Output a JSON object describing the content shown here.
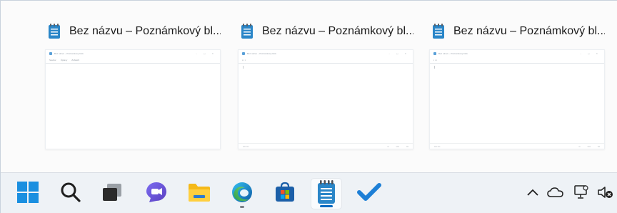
{
  "thumbnails": [
    {
      "title": "Bez názvu – Poznámkový bl...",
      "preview": {
        "app_title": "Bez názvu – Poznámkový blok",
        "menu": [
          "Soubor",
          "Úpravy",
          "Zobrazit"
        ],
        "status_left": "",
        "status_right": []
      }
    },
    {
      "title": "Bez názvu – Poznámkový bl...",
      "preview": {
        "app_title": "Bez názvu – Poznámkový blok",
        "menu": [],
        "status_left": "",
        "status_right": []
      }
    },
    {
      "title": "Bez názvu – Poznámkový bl...",
      "preview": {
        "app_title": "Bez názvu – Poznámkový blok",
        "menu": [],
        "status_left": "",
        "status_right": []
      }
    }
  ],
  "taskbar": {
    "apps": [
      {
        "name": "start",
        "icon": "windows-logo-icon"
      },
      {
        "name": "search",
        "icon": "search-icon"
      },
      {
        "name": "task-view",
        "icon": "task-view-icon"
      },
      {
        "name": "meet",
        "icon": "video-chat-icon"
      },
      {
        "name": "file-explorer",
        "icon": "folder-icon"
      },
      {
        "name": "edge",
        "icon": "edge-browser-icon"
      },
      {
        "name": "store",
        "icon": "store-icon"
      },
      {
        "name": "notepad",
        "icon": "notepad-icon",
        "active": true
      },
      {
        "name": "todo",
        "icon": "checkmark-icon"
      }
    ],
    "tray": [
      "chevron-up-icon",
      "onedrive-cloud-icon",
      "network-icon",
      "volume-muted-icon"
    ]
  },
  "colors": {
    "accent": "#0067c0",
    "notepad_blue": "#2a86c8",
    "taskbar_bg": "#eef2f6"
  }
}
